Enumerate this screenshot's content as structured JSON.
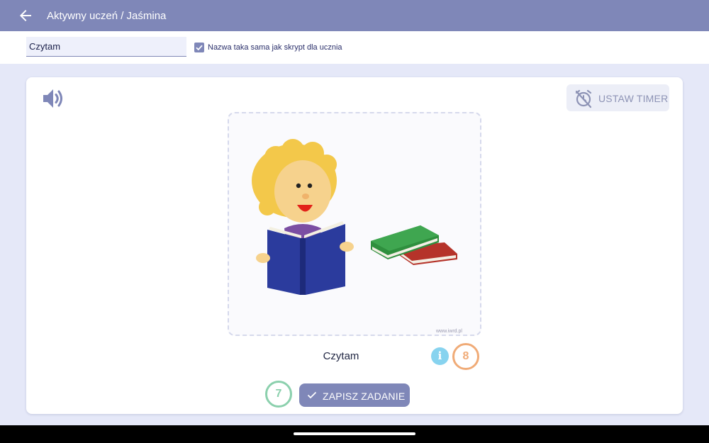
{
  "header": {
    "title": "Aktywny uczeń / Jaśmina",
    "back_icon": "arrow-left-icon"
  },
  "toolbar": {
    "name_value": "Czytam",
    "same_as_script_checked": true,
    "same_as_script_label": "Nazwa taka sama jak skrypt dla ucznia"
  },
  "task": {
    "speaker_icon": "speaker-volume-icon",
    "timer_button_label": "USTAW TIMER",
    "timer_icon": "alarm-off-icon",
    "image_watermark": "www.iwrd.pl",
    "caption": "Czytam",
    "info_badge": "i",
    "caption_count": "8",
    "save_count": "7",
    "save_button_label": "ZAPISZ ZADANIE",
    "save_icon": "check-icon"
  },
  "colors": {
    "primary": "#7f87b8",
    "background": "#e5e8f8",
    "info": "#87d3ef",
    "orange": "#f0ab77",
    "green": "#8bd0ad"
  }
}
